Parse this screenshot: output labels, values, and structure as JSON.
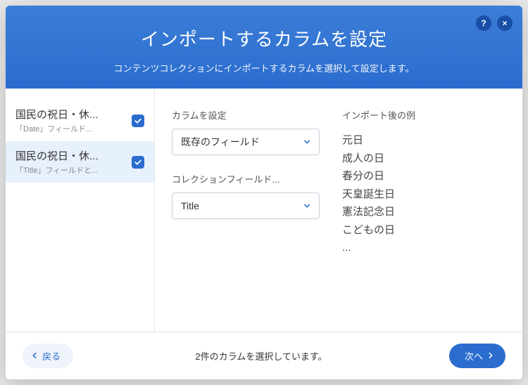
{
  "header": {
    "title": "インポートするカラムを設定",
    "subtitle": "コンテンツコレクションにインポートするカラムを選択して設定します。",
    "help_label": "?",
    "close_label": "×"
  },
  "sidebar": {
    "items": [
      {
        "title": "国民の祝日・休...",
        "subtitle": "「Date」フィールド..."
      },
      {
        "title": "国民の祝日・休...",
        "subtitle": "「Title」フィールドと..."
      }
    ]
  },
  "form": {
    "set_column_label": "カラムを設定",
    "set_column_value": "既存のフィールド",
    "collection_field_label": "コレクションフィールド...",
    "collection_field_value": "Title"
  },
  "preview": {
    "label": "インポート後の例",
    "items": [
      "元日",
      "成人の日",
      "春分の日",
      "天皇誕生日",
      "憲法記念日",
      "こどもの日",
      "..."
    ]
  },
  "footer": {
    "back_label": "戻る",
    "status": "2件のカラムを選択しています。",
    "next_label": "次へ"
  }
}
